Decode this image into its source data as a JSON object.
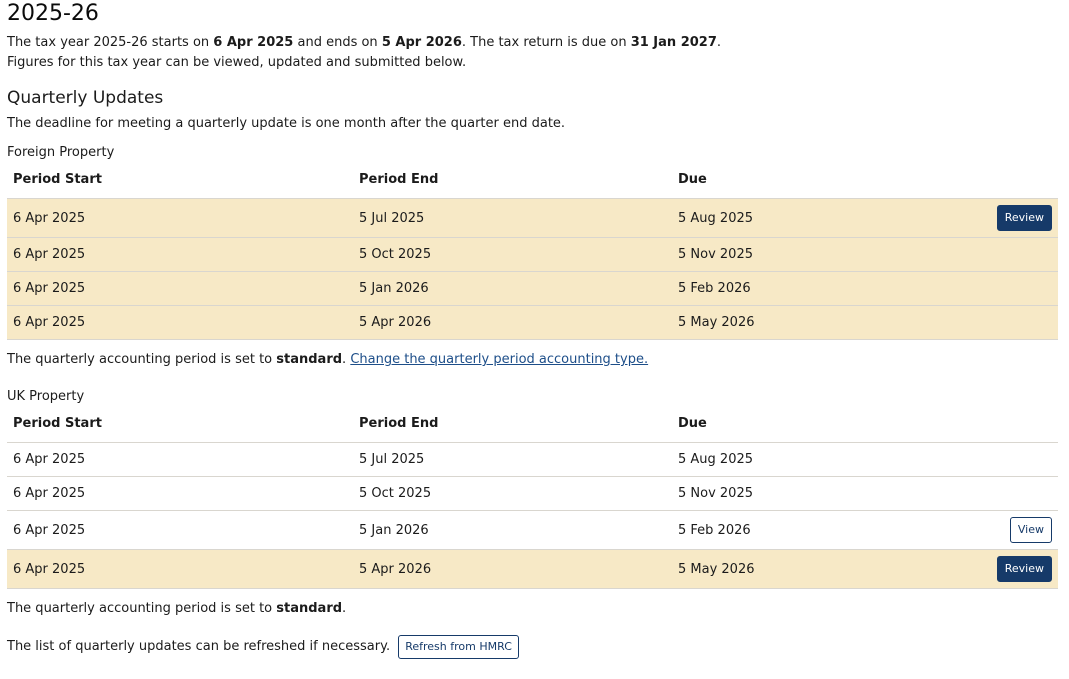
{
  "year": {
    "title": "2025-26",
    "intro_1": "The tax year 2025-26 starts on ",
    "start": "6 Apr 2025",
    "intro_2": " and ends on ",
    "end": "5 Apr 2026",
    "intro_3": ". The tax return is due on ",
    "due": "31 Jan 2027",
    "intro_4": ".",
    "intro_line2": "Figures for this tax year can be viewed, updated and submitted below."
  },
  "quarterly": {
    "heading": "Quarterly Updates",
    "deadline_text": "The deadline for meeting a quarterly update is one month after the quarter end date."
  },
  "headers": {
    "start": "Period Start",
    "end": "Period End",
    "due": "Due"
  },
  "foreign": {
    "title": "Foreign Property",
    "rows": [
      {
        "start": "6 Apr 2025",
        "end": "5 Jul 2025",
        "due": "5 Aug 2025",
        "action": "Review"
      },
      {
        "start": "6 Apr 2025",
        "end": "5 Oct 2025",
        "due": "5 Nov 2025",
        "action": ""
      },
      {
        "start": "6 Apr 2025",
        "end": "5 Jan 2026",
        "due": "5 Feb 2026",
        "action": ""
      },
      {
        "start": "6 Apr 2025",
        "end": "5 Apr 2026",
        "due": "5 May 2026",
        "action": ""
      }
    ],
    "note_prefix": "The quarterly accounting period is set to ",
    "note_value": "standard",
    "note_suffix": ". ",
    "note_link": "Change the quarterly period accounting type."
  },
  "uk": {
    "title": "UK Property",
    "rows": [
      {
        "start": "6 Apr 2025",
        "end": "5 Jul 2025",
        "due": "5 Aug 2025",
        "action": ""
      },
      {
        "start": "6 Apr 2025",
        "end": "5 Oct 2025",
        "due": "5 Nov 2025",
        "action": ""
      },
      {
        "start": "6 Apr 2025",
        "end": "5 Jan 2026",
        "due": "5 Feb 2026",
        "action": "View"
      },
      {
        "start": "6 Apr 2025",
        "end": "5 Apr 2026",
        "due": "5 May 2026",
        "action": "Review"
      }
    ],
    "note_prefix": "The quarterly accounting period is set to ",
    "note_value": "standard",
    "note_suffix": "."
  },
  "refresh": {
    "text": "The list of quarterly updates can be refreshed if necessary.",
    "button": "Refresh from HMRC"
  },
  "colors": {
    "highlight": "#f7e9c6",
    "primary": "#163a69",
    "link": "#1d4e89"
  }
}
